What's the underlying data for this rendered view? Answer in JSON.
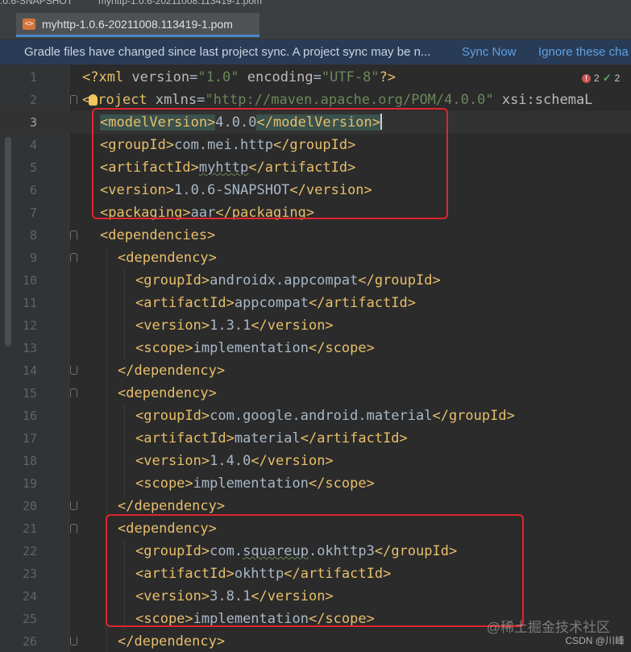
{
  "window": {
    "breadcrumb_left": ".0.6-SNAPSHOT",
    "breadcrumb_file": "myhttp-1.0.6-20211008.113419-1.pom"
  },
  "tab": {
    "icon_label": "<>",
    "title": "myhttp-1.0.6-20211008.113419-1.pom",
    "icon": "xml-file-icon"
  },
  "notification": {
    "message": "Gradle files have changed since last project sync. A project sync may be n...",
    "sync_now": "Sync Now",
    "ignore": "Ignore these cha"
  },
  "inspections": {
    "errors": "2",
    "warnings": "2",
    "error_icon": "error-icon",
    "ok_icon": "check-icon"
  },
  "editor": {
    "current_line": "3",
    "lines": [
      {
        "n": "1",
        "fold": "",
        "indent": 0,
        "tokens": [
          {
            "c": "t",
            "s": "<?xml "
          },
          {
            "c": "a",
            "s": "version"
          },
          {
            "c": "txt",
            "s": "="
          },
          {
            "c": "v",
            "s": "\"1.0\""
          },
          {
            "c": "txt",
            "s": " "
          },
          {
            "c": "a",
            "s": "encoding"
          },
          {
            "c": "txt",
            "s": "="
          },
          {
            "c": "v",
            "s": "\"UTF-8\""
          },
          {
            "c": "t",
            "s": "?>"
          }
        ]
      },
      {
        "n": "2",
        "fold": "open",
        "indent": 0,
        "tokens": [
          {
            "c": "t",
            "s": "<"
          },
          {
            "c": "bulb",
            "s": ""
          },
          {
            "c": "t",
            "s": "roject "
          },
          {
            "c": "a",
            "s": "xmlns"
          },
          {
            "c": "txt",
            "s": "="
          },
          {
            "c": "v",
            "s": "\"http://maven.apache.org/POM/4.0.0\""
          },
          {
            "c": "txt",
            "s": " "
          },
          {
            "c": "a",
            "s": "xsi:schemaL"
          }
        ]
      },
      {
        "n": "3",
        "fold": "",
        "indent": 1,
        "tokens": [
          {
            "c": "t sel",
            "s": "<modelVersion>"
          },
          {
            "c": "txt",
            "s": "4.0.0"
          },
          {
            "c": "t sel",
            "s": "</modelVersion>"
          },
          {
            "c": "caret",
            "s": ""
          }
        ]
      },
      {
        "n": "4",
        "fold": "",
        "indent": 1,
        "tokens": [
          {
            "c": "t",
            "s": "<groupId>"
          },
          {
            "c": "txt",
            "s": "com.mei.http"
          },
          {
            "c": "t",
            "s": "</groupId>"
          }
        ]
      },
      {
        "n": "5",
        "fold": "",
        "indent": 1,
        "tokens": [
          {
            "c": "t",
            "s": "<artifactId>"
          },
          {
            "c": "txt typo",
            "s": "myhttp"
          },
          {
            "c": "t",
            "s": "</artifactId>"
          }
        ]
      },
      {
        "n": "6",
        "fold": "",
        "indent": 1,
        "tokens": [
          {
            "c": "t",
            "s": "<version>"
          },
          {
            "c": "txt",
            "s": "1.0.6-SNAPSHOT"
          },
          {
            "c": "t",
            "s": "</version>"
          }
        ]
      },
      {
        "n": "7",
        "fold": "",
        "indent": 1,
        "tokens": [
          {
            "c": "t",
            "s": "<packaging>"
          },
          {
            "c": "txt",
            "s": "aar"
          },
          {
            "c": "t",
            "s": "</packaging>"
          }
        ]
      },
      {
        "n": "8",
        "fold": "open",
        "indent": 1,
        "tokens": [
          {
            "c": "t",
            "s": "<dependencies>"
          }
        ]
      },
      {
        "n": "9",
        "fold": "open",
        "indent": 2,
        "tokens": [
          {
            "c": "t",
            "s": "<dependency>"
          }
        ]
      },
      {
        "n": "10",
        "fold": "",
        "indent": 3,
        "tokens": [
          {
            "c": "t",
            "s": "<groupId>"
          },
          {
            "c": "txt",
            "s": "androidx.appcompat"
          },
          {
            "c": "t",
            "s": "</groupId>"
          }
        ]
      },
      {
        "n": "11",
        "fold": "",
        "indent": 3,
        "tokens": [
          {
            "c": "t",
            "s": "<artifactId>"
          },
          {
            "c": "txt",
            "s": "appcompat"
          },
          {
            "c": "t",
            "s": "</artifactId>"
          }
        ]
      },
      {
        "n": "12",
        "fold": "",
        "indent": 3,
        "tokens": [
          {
            "c": "t",
            "s": "<version>"
          },
          {
            "c": "txt",
            "s": "1.3.1"
          },
          {
            "c": "t",
            "s": "</version>"
          }
        ]
      },
      {
        "n": "13",
        "fold": "",
        "indent": 3,
        "tokens": [
          {
            "c": "t",
            "s": "<scope>"
          },
          {
            "c": "txt",
            "s": "implementation"
          },
          {
            "c": "t",
            "s": "</scope>"
          }
        ]
      },
      {
        "n": "14",
        "fold": "close",
        "indent": 2,
        "tokens": [
          {
            "c": "t",
            "s": "</dependency>"
          }
        ]
      },
      {
        "n": "15",
        "fold": "open",
        "indent": 2,
        "tokens": [
          {
            "c": "t",
            "s": "<dependency>"
          }
        ]
      },
      {
        "n": "16",
        "fold": "",
        "indent": 3,
        "tokens": [
          {
            "c": "t",
            "s": "<groupId>"
          },
          {
            "c": "txt",
            "s": "com.google.android.material"
          },
          {
            "c": "t",
            "s": "</groupId>"
          }
        ]
      },
      {
        "n": "17",
        "fold": "",
        "indent": 3,
        "tokens": [
          {
            "c": "t",
            "s": "<artifactId>"
          },
          {
            "c": "txt",
            "s": "material"
          },
          {
            "c": "t",
            "s": "</artifactId>"
          }
        ]
      },
      {
        "n": "18",
        "fold": "",
        "indent": 3,
        "tokens": [
          {
            "c": "t",
            "s": "<version>"
          },
          {
            "c": "txt",
            "s": "1.4.0"
          },
          {
            "c": "t",
            "s": "</version>"
          }
        ]
      },
      {
        "n": "19",
        "fold": "",
        "indent": 3,
        "tokens": [
          {
            "c": "t",
            "s": "<scope>"
          },
          {
            "c": "txt",
            "s": "implementation"
          },
          {
            "c": "t",
            "s": "</scope>"
          }
        ]
      },
      {
        "n": "20",
        "fold": "close",
        "indent": 2,
        "tokens": [
          {
            "c": "t",
            "s": "</dependency>"
          }
        ]
      },
      {
        "n": "21",
        "fold": "open",
        "indent": 2,
        "tokens": [
          {
            "c": "t",
            "s": "<dependency>"
          }
        ]
      },
      {
        "n": "22",
        "fold": "",
        "indent": 3,
        "tokens": [
          {
            "c": "t",
            "s": "<groupId>"
          },
          {
            "c": "txt",
            "s": "com."
          },
          {
            "c": "txt typo",
            "s": "squareup"
          },
          {
            "c": "txt",
            "s": ".okhttp3"
          },
          {
            "c": "t",
            "s": "</groupId>"
          }
        ]
      },
      {
        "n": "23",
        "fold": "",
        "indent": 3,
        "tokens": [
          {
            "c": "t",
            "s": "<artifactId>"
          },
          {
            "c": "txt",
            "s": "okhttp"
          },
          {
            "c": "t",
            "s": "</artifactId>"
          }
        ]
      },
      {
        "n": "24",
        "fold": "",
        "indent": 3,
        "tokens": [
          {
            "c": "t",
            "s": "<version>"
          },
          {
            "c": "txt",
            "s": "3.8.1"
          },
          {
            "c": "t",
            "s": "</version>"
          }
        ]
      },
      {
        "n": "25",
        "fold": "",
        "indent": 3,
        "tokens": [
          {
            "c": "t",
            "s": "<scope>"
          },
          {
            "c": "txt",
            "s": "implementation"
          },
          {
            "c": "t",
            "s": "</scope>"
          }
        ]
      },
      {
        "n": "26",
        "fold": "close",
        "indent": 2,
        "tokens": [
          {
            "c": "t",
            "s": "</dependency>"
          }
        ]
      }
    ]
  },
  "watermark": "@稀土掘金技术社区",
  "csdn_credit": "CSDN @川峰",
  "colors": {
    "tag": "#e8bf6a",
    "attribute": "#bababa",
    "string": "#6a8759",
    "text": "#a9b7c6",
    "highlight_box": "#e0262e",
    "link": "#5f9fe3"
  }
}
